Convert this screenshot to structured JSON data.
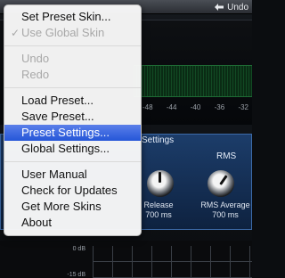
{
  "topbar": {
    "undo_label": "Undo"
  },
  "meter": {
    "scale": [
      "-48",
      "-44",
      "-40",
      "-36",
      "-32"
    ]
  },
  "settings": {
    "title": "Settings",
    "rms_title": "RMS",
    "release": {
      "label": "Release",
      "value": "700 ms"
    },
    "rms_average": {
      "label": "RMS Average",
      "value": "700 ms"
    }
  },
  "graph": {
    "db_labels": [
      "0 dB",
      "-15 dB"
    ]
  },
  "menu": {
    "set_preset_skin": "Set Preset Skin...",
    "use_global_skin": "Use Global Skin",
    "use_global_skin_check": "✓",
    "undo": "Undo",
    "redo": "Redo",
    "load_preset": "Load Preset...",
    "save_preset": "Save Preset...",
    "preset_settings": "Preset Settings...",
    "global_settings": "Global Settings...",
    "user_manual": "User Manual",
    "check_updates": "Check for Updates",
    "get_more_skins": "Get More Skins",
    "about": "About"
  },
  "colors": {
    "menu_highlight": "#2f5fe0",
    "settings_panel": "#1c3d6a",
    "meter_green": "#124a24"
  }
}
